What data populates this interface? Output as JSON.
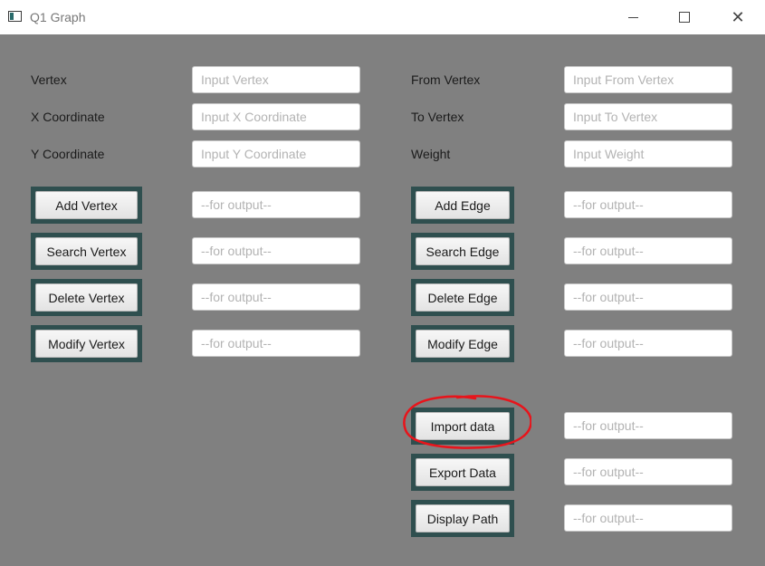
{
  "window": {
    "title": "Q1 Graph",
    "min_icon": "minimize-icon",
    "max_icon": "maximize-icon",
    "close_icon": "close-icon",
    "close_glyph": "✕"
  },
  "vertex_form": {
    "vertex_label": "Vertex",
    "vertex_placeholder": "Input Vertex",
    "x_label": "X Coordinate",
    "x_placeholder": "Input X Coordinate",
    "y_label": "Y Coordinate",
    "y_placeholder": "Input Y Coordinate"
  },
  "edge_form": {
    "from_label": "From Vertex",
    "from_placeholder": "Input From Vertex",
    "to_label": "To Vertex",
    "to_placeholder": "Input To Vertex",
    "weight_label": "Weight",
    "weight_placeholder": "Input Weight"
  },
  "vertex_actions": [
    {
      "label": "Add Vertex",
      "output_placeholder": "--for output--"
    },
    {
      "label": "Search Vertex",
      "output_placeholder": "--for output--"
    },
    {
      "label": "Delete Vertex",
      "output_placeholder": "--for output--"
    },
    {
      "label": "Modify Vertex",
      "output_placeholder": "--for output--"
    }
  ],
  "edge_actions": [
    {
      "label": "Add Edge",
      "output_placeholder": "--for output--"
    },
    {
      "label": "Search Edge",
      "output_placeholder": "--for output--"
    },
    {
      "label": "Delete Edge",
      "output_placeholder": "--for output--"
    },
    {
      "label": "Modify Edge",
      "output_placeholder": "--for output--"
    }
  ],
  "data_actions": [
    {
      "label": "Import data",
      "output_placeholder": "--for output--"
    },
    {
      "label": "Export Data",
      "output_placeholder": "--for output--"
    },
    {
      "label": "Display Path",
      "output_placeholder": "--for output--"
    }
  ],
  "annotation": {
    "color": "#e8141b",
    "target": "Import data"
  }
}
